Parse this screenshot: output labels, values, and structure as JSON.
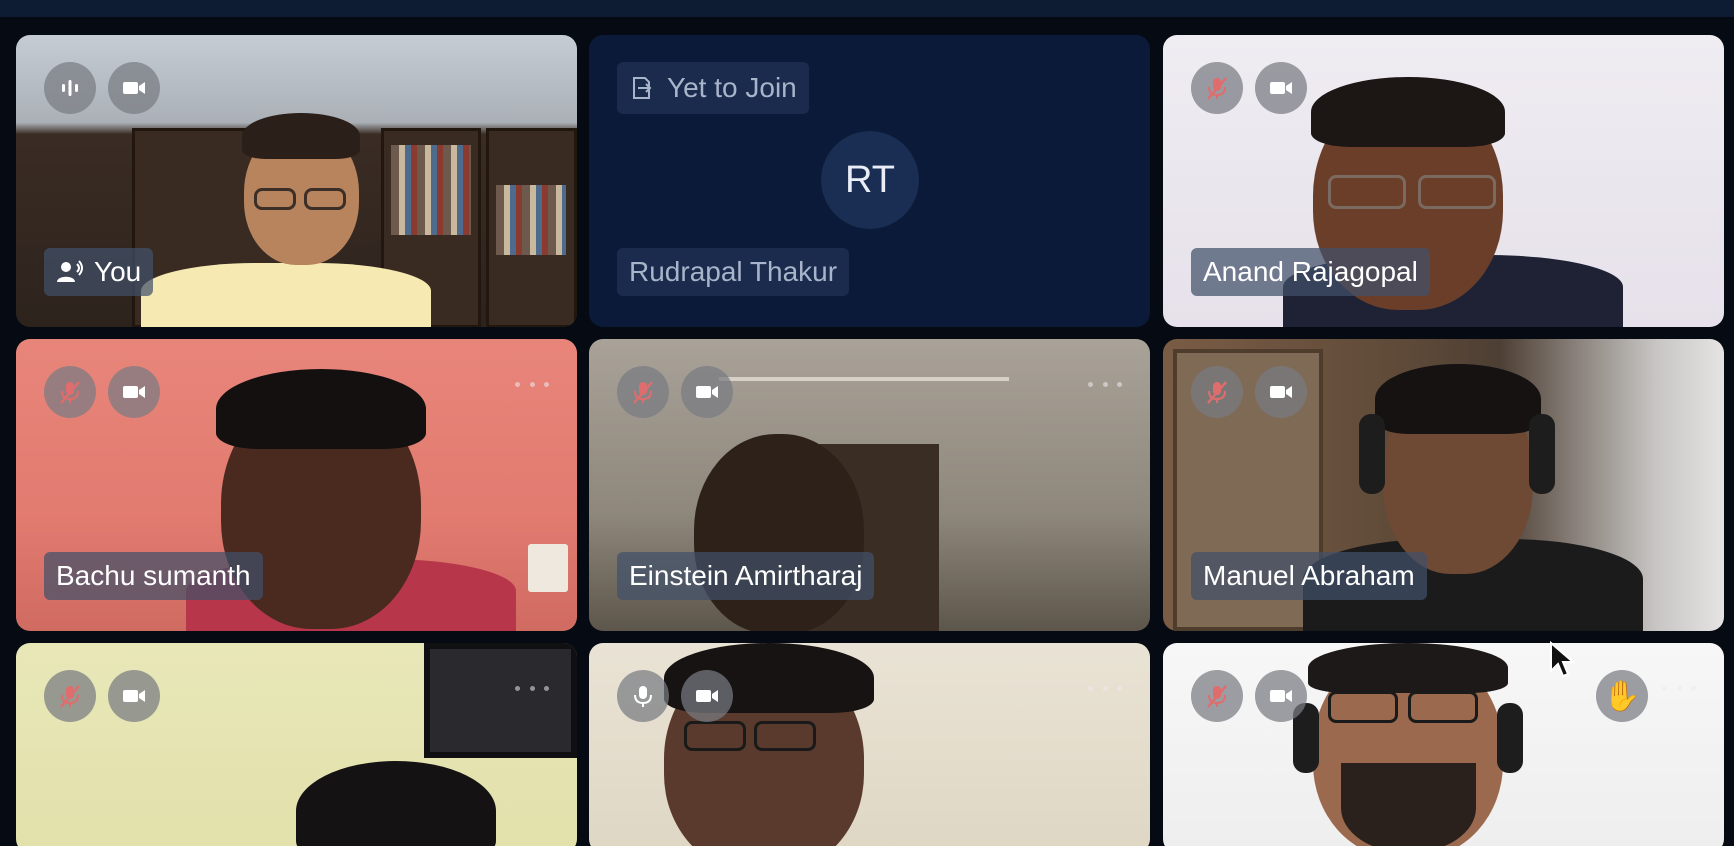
{
  "participants": [
    {
      "name": "You",
      "status": "speaking"
    },
    {
      "name": "Rudrapal Thakur",
      "initials": "RT",
      "state": "Yet to Join"
    },
    {
      "name": "Anand Rajagopal",
      "mic": "muted"
    },
    {
      "name": "Bachu sumanth",
      "mic": "muted"
    },
    {
      "name": "Einstein Amirtharaj",
      "mic": "muted"
    },
    {
      "name": "Manuel Abraham",
      "mic": "muted"
    },
    {
      "name": "",
      "mic": "muted"
    },
    {
      "name": "",
      "mic": "on"
    },
    {
      "name": "",
      "mic": "muted",
      "hand_raised": true
    }
  ],
  "colors": {
    "background": "#060a13",
    "topbar": "#0e1c33",
    "absent_tile": "#0b1a38",
    "muted_mic": "#e06d6d",
    "raised_hand": "#f0c04c"
  }
}
